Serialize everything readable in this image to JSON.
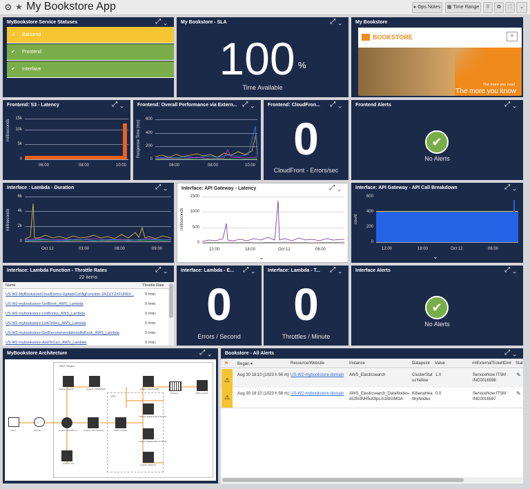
{
  "header": {
    "title": "My Bookstore App",
    "ops_notes": "Ops Notes",
    "time_range": "Time Range"
  },
  "service_statuses": {
    "title": "MyBookstore Service Statuses",
    "items": [
      "Backend",
      "Frontend",
      "Interface"
    ]
  },
  "sla": {
    "title": "My Bookstore - SLA",
    "value": "100",
    "unit": "%",
    "caption": "Time Available"
  },
  "bookstore_img": {
    "title": "My Bookstore",
    "brand": "BOOKSTORE",
    "tag1": "The more you read",
    "tag2": "The more you know"
  },
  "s3": {
    "title": "Frontend: S3 - Latency",
    "ylabel": "milliseconds",
    "yticks": [
      "15k",
      "10k",
      "5k",
      "0"
    ],
    "xticks": [
      "06:00",
      "08:00",
      "10:00"
    ]
  },
  "overall": {
    "title": "Frontend: Overall Performance via Extern...",
    "ylabel": "Response Time (ms)",
    "yticks": [
      "600",
      "400",
      "200",
      "0"
    ],
    "xticks": [
      "06:00",
      "08:00",
      "10:00"
    ]
  },
  "cloudfront": {
    "title": "Frontend: CloudFron...",
    "value": "0",
    "caption": "CloudFront - Errors/sec"
  },
  "frontend_alerts": {
    "title": "Frontend Alerts",
    "caption": "No Alerts"
  },
  "lambda_dur": {
    "title": "Interface : Lambda - Duration",
    "ylabel": "milliseconds",
    "yticks": [
      "6k",
      "4k",
      "2k",
      "0"
    ],
    "xticks": [
      "Oct 12",
      "03:00",
      "06:00",
      "09:00"
    ]
  },
  "apigw": {
    "title": "Interface: API Gateway - Latency",
    "ylabel": "milliseconds",
    "yticks": [
      "1500",
      "1000",
      "500",
      "0"
    ],
    "xticks": [
      "12:00",
      "18:00",
      "Oct 12",
      "06:00"
    ]
  },
  "apigw_calls": {
    "title": "Interface: API Gateway - API Call Breakdown",
    "ylabel": "count",
    "yticks": [
      "600",
      "400",
      "200",
      "0"
    ],
    "xticks": [
      "12:00",
      "18:00",
      "Oct 12",
      "06:00"
    ]
  },
  "throttle": {
    "title": "Interface: Lambda Function - Throttle Rates",
    "count": "22 items",
    "col_name": "Name",
    "col_rate": "Throttle Rate",
    "rows": [
      {
        "name": "US-W2-MyBookstoreCloudDemo-UpdateConfigFunction-1RZUY2XFUN6V...",
        "rate": "0 /min."
      },
      {
        "name": "US-W2-mybookstore-GetBook_AWS_Lambda",
        "rate": "0 /min."
      },
      {
        "name": "US-W2-mybookstore-ListBooks_AWS_Lambda",
        "rate": "0 /min."
      },
      {
        "name": "US-W2-mybookstore-ListOrders_AWS_Lambda",
        "rate": "0 /min."
      },
      {
        "name": "US-W2-mybookstore-GetRecommendationsByBook_AWS_Lambda",
        "rate": "0 /min."
      },
      {
        "name": "US-W2-mybookstore-AddToCart_AWS_Lambda",
        "rate": "0 /min."
      }
    ]
  },
  "lambda_err": {
    "title": "Interface: Lambda - E...",
    "value": "0",
    "caption": "Errors / Second"
  },
  "lambda_thr": {
    "title": "Interface: Lambda - T...",
    "value": "0",
    "caption": "Throttles / Minute"
  },
  "iface_alerts": {
    "title": "Interface Alerts",
    "caption": "No Alerts"
  },
  "arch": {
    "title": "MyBookstore Architecture",
    "region": "AWS Region",
    "vpc": "VPC",
    "nodes": [
      "Amazon Cognito",
      "Amazon CloudWatch",
      "Amazon DynamoDB",
      "Client",
      "Internet",
      "Amazon CloudFront",
      "Amazon API Gateway",
      "AWS Lambda",
      "Amazon Elasticsearch Service",
      "Amazon ElastiCache for Redis",
      "Amazon S3",
      "Amazon Neptune",
      "Streams",
      "AWS Lambda"
    ]
  },
  "alerts": {
    "title": "Bookstore - All Alerts",
    "cols": [
      "Began",
      "Resource/Website",
      "Instance",
      "Datapoint",
      "Value",
      "##ExternalTicketID##",
      "Stat"
    ],
    "rows": [
      {
        "began": "Aug 30 18:10 (1023 h 56 m)",
        "resource": "US-W2-mybookstore-domain",
        "instance": "AWS_Elasticsearch",
        "datapoint": "ClusterStatusYellow",
        "value": "1.0",
        "ticket": "ServiceNow ITSM : INC0016598"
      },
      {
        "began": "Aug 30 18:10 (1023 h 56 m)",
        "resource": "US-W2-mybookstore-domain",
        "instance": "AWS_Elasticsearch_DataNodes-dCtfndNH5uOlpLm1BtGMOA",
        "datapoint": "KibanaHealthyNodes",
        "value": "0.0",
        "ticket": "ServiceNow ITSM : INC0016597"
      }
    ]
  }
}
